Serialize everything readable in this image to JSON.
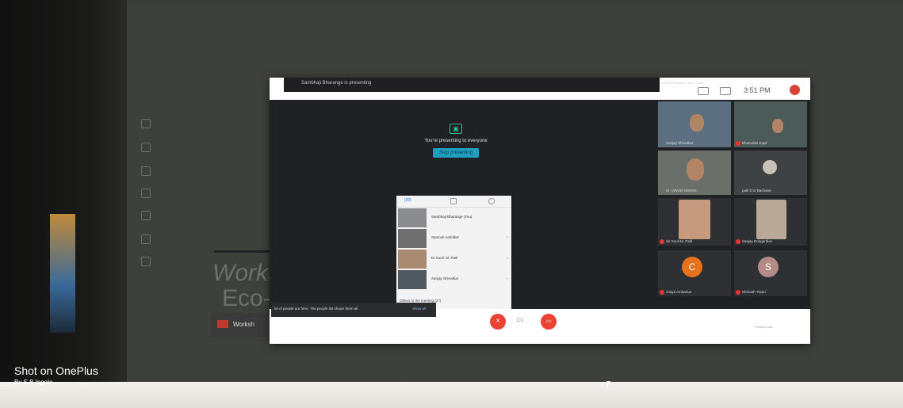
{
  "watermark": {
    "line1": "Shot on OnePlus",
    "line2": "By S.B.Ingole"
  },
  "slide": {
    "big_line1": "Works",
    "big_line2": "Eco-",
    "logo_text": "Worksh"
  },
  "meet": {
    "presenting_banner": "Sambhaji Bharange is presenting",
    "video_strip_label": "SURESH BANGI and 11 more",
    "clock": "3:51 PM",
    "presenting_message": "You're presenting to everyone",
    "stop_presenting": "Stop presenting",
    "participants_tab_count": "(30)",
    "people": [
      {
        "name": "Sambhaji Bharange (You)"
      },
      {
        "name": "Santosh Ambilkar"
      },
      {
        "name": "Dr.Sunil. M. Patil"
      },
      {
        "name": "Sanjay Shirodkar"
      }
    ],
    "others_in_meeting": "Others in the meeting (27)",
    "toast_text": "lot of people are here. The people list shows them all.",
    "toast_link": "Show all",
    "tiles": [
      {
        "name": "Sanjay Shirodkar"
      },
      {
        "name": "Bhanudas Kapil"
      },
      {
        "name": "Dr. VINOD HONNA"
      },
      {
        "name": "patil G D Bachane"
      },
      {
        "name": "Sir Sunil M. Patil"
      },
      {
        "name": "Sanjay Dongardive"
      },
      {
        "name": "chaya Ambarkar",
        "initial": "C"
      },
      {
        "name": "Shrinath Tiwari",
        "initial": "S"
      }
    ],
    "controls": {
      "cc_label": "CC",
      "activities_label": "Present now"
    }
  },
  "colors": {
    "end_call": "#ea4335",
    "accent": "#1e9fc0",
    "present_icon": "#2bbf8f"
  }
}
